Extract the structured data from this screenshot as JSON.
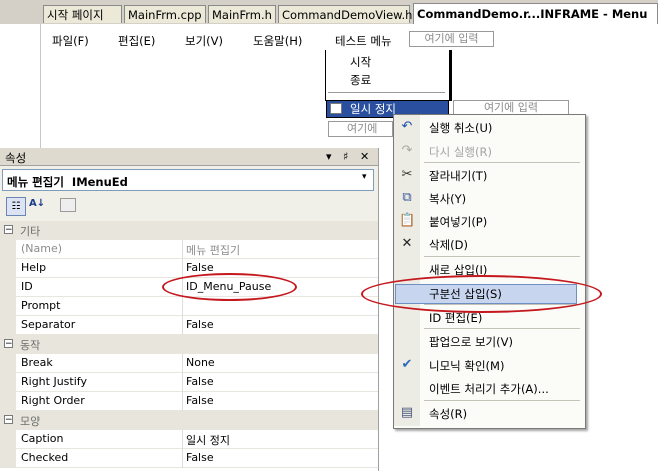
{
  "tabs": [
    "시작 페이지",
    "MainFrm.cpp",
    "MainFrm.h",
    "CommandDemoView.h",
    "CommandDemo.r...INFRAME - Menu"
  ],
  "menubar": {
    "items": [
      "파일(F)",
      "편집(E)",
      "보기(V)",
      "도움말(H)",
      "테스트 메뉴"
    ],
    "type_here": "여기에 입력"
  },
  "dropdown": {
    "items": [
      "시작",
      "종료",
      "일시 정지"
    ],
    "type_here_right": "여기에 입력",
    "type_here_bottom": "여기에"
  },
  "properties": {
    "title": "속성",
    "title_buttons": [
      "▾",
      "♯",
      "✕"
    ],
    "object": "메뉴 편집기  IMenuEd",
    "rows": [
      {
        "type": "cat",
        "name": "기타"
      },
      {
        "type": "prop",
        "name": "(Name)",
        "value": "메뉴 편집기",
        "dim": true
      },
      {
        "type": "prop",
        "name": "Help",
        "value": "False"
      },
      {
        "type": "prop",
        "name": "ID",
        "value": "ID_Menu_Pause"
      },
      {
        "type": "prop",
        "name": "Prompt",
        "value": ""
      },
      {
        "type": "prop",
        "name": "Separator",
        "value": "False"
      },
      {
        "type": "cat",
        "name": "동작"
      },
      {
        "type": "prop",
        "name": "Break",
        "value": "None"
      },
      {
        "type": "prop",
        "name": "Right Justify",
        "value": "False"
      },
      {
        "type": "prop",
        "name": "Right Order",
        "value": "False"
      },
      {
        "type": "cat",
        "name": "모양"
      },
      {
        "type": "prop",
        "name": "Caption",
        "value": "일시 정지"
      },
      {
        "type": "prop",
        "name": "Checked",
        "value": "False"
      }
    ]
  },
  "context_menu": {
    "items": [
      {
        "label": "실행 취소(U)",
        "icon": "undo-icon"
      },
      {
        "label": "다시 실행(R)",
        "icon": "redo-icon",
        "disabled": true
      },
      {
        "label": "잘라내기(T)",
        "icon": "cut-icon"
      },
      {
        "label": "복사(Y)",
        "icon": "copy-icon"
      },
      {
        "label": "붙여넣기(P)",
        "icon": "paste-icon"
      },
      {
        "label": "삭제(D)",
        "icon": "delete-icon"
      },
      {
        "label": "새로 삽입(I)"
      },
      {
        "label": "구분선 삽입(S)",
        "highlighted": true
      },
      {
        "label": "ID 편집(E)"
      },
      {
        "label": "팝업으로 보기(V)"
      },
      {
        "label": "니모닉 확인(M)",
        "icon": "mnemonic-check-icon"
      },
      {
        "label": "이벤트 처리기 추가(A)..."
      },
      {
        "label": "속성(R)",
        "icon": "properties-icon"
      }
    ]
  },
  "colors": {
    "highlight_ellipse": "#c4181e",
    "selection_blue": "#2a4f9e",
    "menu_hover": "#c7d5ee"
  }
}
